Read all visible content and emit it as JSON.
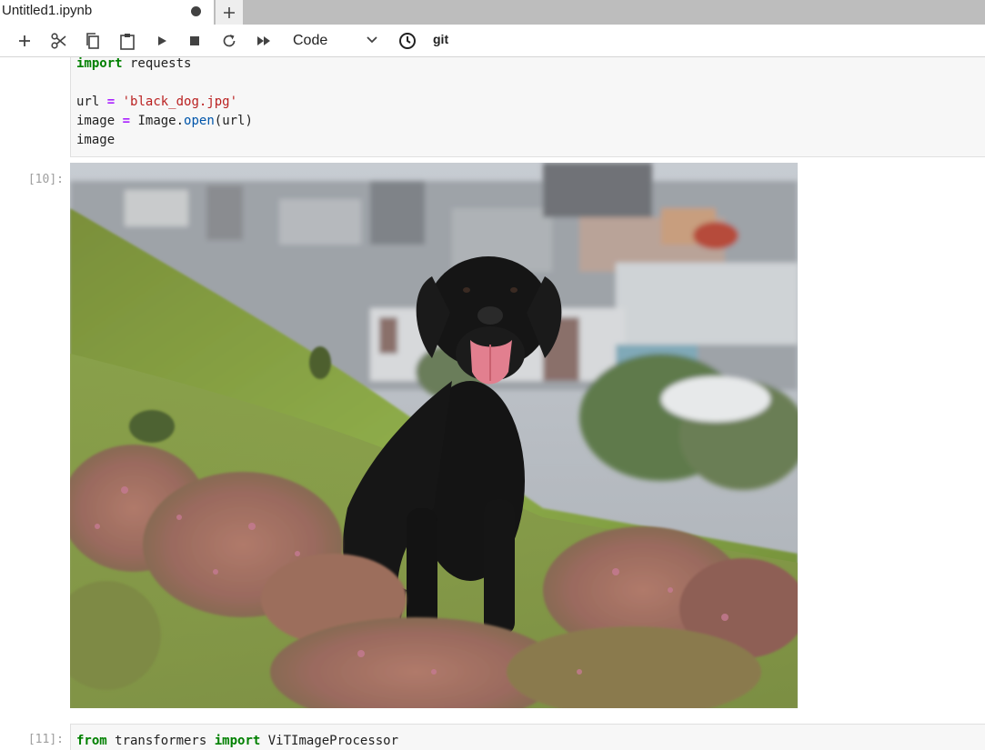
{
  "tab": {
    "title": "Untitled1.ipynb",
    "unsaved_icon": "filled-circle-icon",
    "add_icon": "plus-icon"
  },
  "toolbar": {
    "buttons": [
      "plus-icon",
      "scissors-icon",
      "copy-icon",
      "clipboard-icon",
      "play-icon",
      "stop-icon",
      "restart-icon",
      "fast-forward-icon"
    ],
    "cell_type": "Code",
    "clock_icon": "clock-icon",
    "git_label": "git"
  },
  "cells": {
    "prev_code": {
      "line1_kw": "import",
      "line1_rest": " requests",
      "line3_var": "url",
      "line3_op": "=",
      "line3_str": "'black_dog.jpg'",
      "line4_var": "image",
      "line4_op": "=",
      "line4_obj": "Image.",
      "line4_fn": "open",
      "line4_args": "(url)",
      "line5": "image"
    },
    "output_prompt": "[10]:",
    "output_image_alt": "black-dog-photo",
    "next_prompt": "[11]:",
    "next_code": {
      "kw1": "from",
      "mod": " transformers ",
      "kw2": "import",
      "name": " ViTImageProcessor"
    }
  },
  "colors": {
    "keyword": "#008000",
    "operator": "#aa22ff",
    "string": "#ba2121",
    "function": "#0055aa",
    "prompt": "#9e9e9e",
    "cell_bg": "#f7f7f7"
  }
}
